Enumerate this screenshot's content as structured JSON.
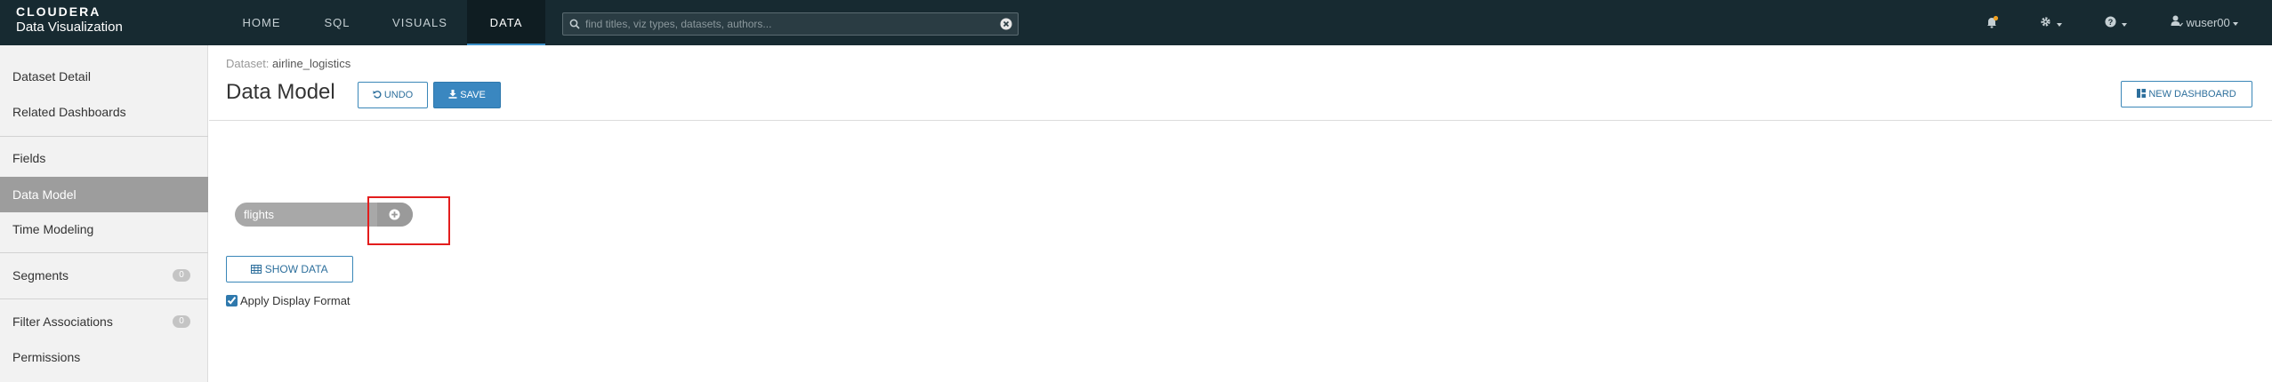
{
  "brand": {
    "top": "CLOUDERA",
    "bottom": "Data Visualization"
  },
  "nav": {
    "tabs": [
      {
        "label": "HOME"
      },
      {
        "label": "SQL"
      },
      {
        "label": "VISUALS"
      },
      {
        "label": "DATA",
        "active": true
      }
    ],
    "search_placeholder": "find titles, viz types, datasets, authors...",
    "user": "wuser00"
  },
  "sidebar": {
    "items": [
      {
        "label": "Dataset Detail"
      },
      {
        "label": "Related Dashboards"
      },
      {
        "label": "Fields"
      },
      {
        "label": "Data Model",
        "active": true
      },
      {
        "label": "Time Modeling"
      },
      {
        "label": "Segments",
        "badge": "0"
      },
      {
        "label": "Filter Associations",
        "badge": "0"
      },
      {
        "label": "Permissions"
      }
    ]
  },
  "header": {
    "dataset_prefix": "Dataset:",
    "dataset_name": "airline_logistics",
    "title": "Data Model",
    "undo_label": "UNDO",
    "save_label": "SAVE",
    "new_dashboard_label": "NEW DASHBOARD"
  },
  "model": {
    "table_name": "flights",
    "show_data_label": "SHOW DATA",
    "apply_display_format_label": "Apply Display Format",
    "apply_display_format_checked": true
  },
  "colors": {
    "topbar": "#172a31",
    "accent": "#3a87c0",
    "highlight": "#e31d1d",
    "notification_dot": "#f0a020"
  },
  "icons": [
    "search-icon",
    "clear-icon",
    "bell-icon",
    "gear-icon",
    "help-icon",
    "user-icon",
    "undo-icon",
    "download-icon",
    "dashboard-icon",
    "plus-circle-icon",
    "table-icon"
  ]
}
